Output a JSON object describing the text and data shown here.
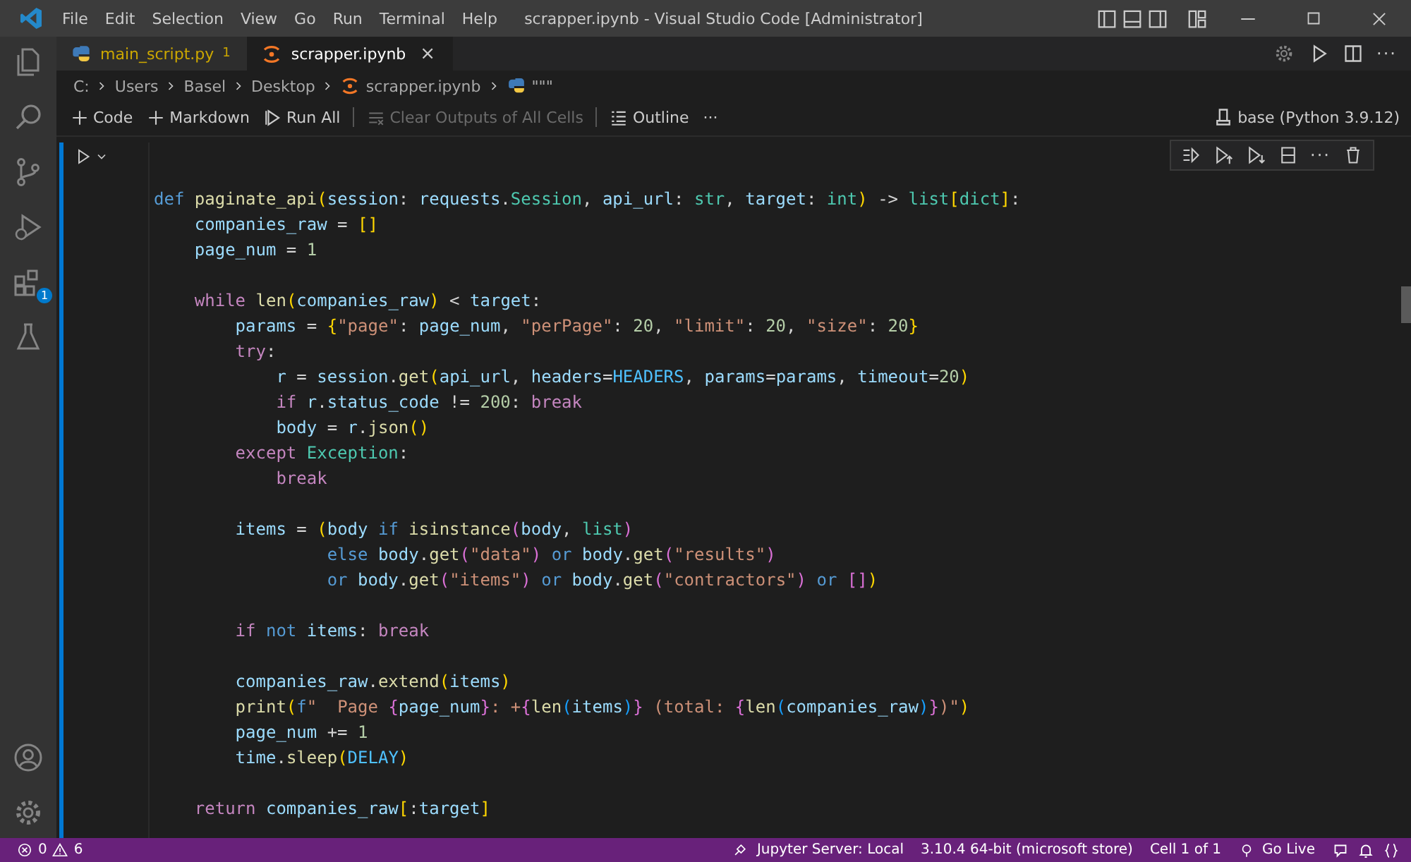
{
  "window": {
    "title": "scrapper.ipynb - Visual Studio Code [Administrator]"
  },
  "menu": [
    "File",
    "Edit",
    "Selection",
    "View",
    "Go",
    "Run",
    "Terminal",
    "Help"
  ],
  "activity_bar": {
    "extensions_badge": "1"
  },
  "tabs": [
    {
      "label": "main_script.py",
      "badge": "1",
      "kind": "python",
      "selected": false
    },
    {
      "label": "scrapper.ipynb",
      "kind": "notebook",
      "selected": true,
      "close": "×"
    }
  ],
  "breadcrumb": [
    {
      "text": "C:",
      "kind": "plain"
    },
    {
      "text": "Users",
      "kind": "plain"
    },
    {
      "text": "Basel",
      "kind": "plain"
    },
    {
      "text": "Desktop",
      "kind": "plain"
    },
    {
      "text": "scrapper.ipynb",
      "kind": "notebook"
    },
    {
      "text": "\"\"\"",
      "kind": "python"
    }
  ],
  "toolbar": [
    {
      "label": "Code",
      "kind": "add",
      "disabled": false
    },
    {
      "label": "Markdown",
      "kind": "add",
      "disabled": false
    },
    {
      "label": "Run All",
      "kind": "run",
      "disabled": false
    },
    {
      "label": "Clear Outputs of All Cells",
      "kind": "clear",
      "disabled": true
    },
    {
      "label": "Outline",
      "kind": "outline",
      "disabled": false
    },
    {
      "label": "···",
      "kind": "more",
      "disabled": false
    }
  ],
  "kernel": "base (Python 3.9.12)",
  "cell_menu": "···",
  "code": [
    {
      "kind": "code",
      "tokens": [
        {
          "kind": "kw",
          "text": "def "
        },
        {
          "kind": "fn",
          "text": "paginate_api"
        },
        {
          "kind": "b1",
          "text": "("
        },
        {
          "kind": "var",
          "text": "session"
        },
        {
          "kind": "op",
          "text": ": "
        },
        {
          "kind": "var",
          "text": "requests"
        },
        {
          "kind": "op",
          "text": "."
        },
        {
          "kind": "cls",
          "text": "Session"
        },
        {
          "kind": "op",
          "text": ", "
        },
        {
          "kind": "var",
          "text": "api_url"
        },
        {
          "kind": "op",
          "text": ": "
        },
        {
          "kind": "cls",
          "text": "str"
        },
        {
          "kind": "op",
          "text": ", "
        },
        {
          "kind": "var",
          "text": "target"
        },
        {
          "kind": "op",
          "text": ": "
        },
        {
          "kind": "cls",
          "text": "int"
        },
        {
          "kind": "b1",
          "text": ")"
        },
        {
          "kind": "op",
          "text": " -> "
        },
        {
          "kind": "cls",
          "text": "list"
        },
        {
          "kind": "b1",
          "text": "["
        },
        {
          "kind": "cls",
          "text": "dict"
        },
        {
          "kind": "b1",
          "text": "]"
        },
        {
          "kind": "op",
          "text": ":"
        }
      ]
    },
    {
      "kind": "code",
      "tokens": [
        {
          "kind": "var",
          "text": "    companies_raw"
        },
        {
          "kind": "op",
          "text": " = "
        },
        {
          "kind": "b1",
          "text": "[]"
        }
      ]
    },
    {
      "kind": "code",
      "tokens": [
        {
          "kind": "var",
          "text": "    page_num"
        },
        {
          "kind": "op",
          "text": " = "
        },
        {
          "kind": "num",
          "text": "1"
        }
      ]
    },
    {
      "kind": "blank"
    },
    {
      "kind": "code",
      "tokens": [
        {
          "kind": "ctl",
          "text": "    while "
        },
        {
          "kind": "fn",
          "text": "len"
        },
        {
          "kind": "b1",
          "text": "("
        },
        {
          "kind": "var",
          "text": "companies_raw"
        },
        {
          "kind": "b1",
          "text": ")"
        },
        {
          "kind": "op",
          "text": " < "
        },
        {
          "kind": "var",
          "text": "target"
        },
        {
          "kind": "op",
          "text": ":"
        }
      ]
    },
    {
      "kind": "code",
      "tokens": [
        {
          "kind": "var",
          "text": "        params"
        },
        {
          "kind": "op",
          "text": " = "
        },
        {
          "kind": "b1",
          "text": "{"
        },
        {
          "kind": "str",
          "text": "\"page\""
        },
        {
          "kind": "op",
          "text": ": "
        },
        {
          "kind": "var",
          "text": "page_num"
        },
        {
          "kind": "op",
          "text": ", "
        },
        {
          "kind": "str",
          "text": "\"perPage\""
        },
        {
          "kind": "op",
          "text": ": "
        },
        {
          "kind": "num",
          "text": "20"
        },
        {
          "kind": "op",
          "text": ", "
        },
        {
          "kind": "str",
          "text": "\"limit\""
        },
        {
          "kind": "op",
          "text": ": "
        },
        {
          "kind": "num",
          "text": "20"
        },
        {
          "kind": "op",
          "text": ", "
        },
        {
          "kind": "str",
          "text": "\"size\""
        },
        {
          "kind": "op",
          "text": ": "
        },
        {
          "kind": "num",
          "text": "20"
        },
        {
          "kind": "b1",
          "text": "}"
        }
      ]
    },
    {
      "kind": "code",
      "tokens": [
        {
          "kind": "ctl",
          "text": "        try"
        },
        {
          "kind": "op",
          "text": ":"
        }
      ]
    },
    {
      "kind": "code",
      "tokens": [
        {
          "kind": "var",
          "text": "            r"
        },
        {
          "kind": "op",
          "text": " = "
        },
        {
          "kind": "var",
          "text": "session"
        },
        {
          "kind": "op",
          "text": "."
        },
        {
          "kind": "fn",
          "text": "get"
        },
        {
          "kind": "b1",
          "text": "("
        },
        {
          "kind": "var",
          "text": "api_url"
        },
        {
          "kind": "op",
          "text": ", "
        },
        {
          "kind": "var",
          "text": "headers"
        },
        {
          "kind": "op",
          "text": "="
        },
        {
          "kind": "const",
          "text": "HEADERS"
        },
        {
          "kind": "op",
          "text": ", "
        },
        {
          "kind": "var",
          "text": "params"
        },
        {
          "kind": "op",
          "text": "="
        },
        {
          "kind": "var",
          "text": "params"
        },
        {
          "kind": "op",
          "text": ", "
        },
        {
          "kind": "var",
          "text": "timeout"
        },
        {
          "kind": "op",
          "text": "="
        },
        {
          "kind": "num",
          "text": "20"
        },
        {
          "kind": "b1",
          "text": ")"
        }
      ]
    },
    {
      "kind": "code",
      "tokens": [
        {
          "kind": "ctl",
          "text": "            if "
        },
        {
          "kind": "var",
          "text": "r"
        },
        {
          "kind": "op",
          "text": "."
        },
        {
          "kind": "var",
          "text": "status_code"
        },
        {
          "kind": "op",
          "text": " != "
        },
        {
          "kind": "num",
          "text": "200"
        },
        {
          "kind": "op",
          "text": ": "
        },
        {
          "kind": "ctl",
          "text": "break"
        }
      ]
    },
    {
      "kind": "code",
      "tokens": [
        {
          "kind": "var",
          "text": "            body"
        },
        {
          "kind": "op",
          "text": " = "
        },
        {
          "kind": "var",
          "text": "r"
        },
        {
          "kind": "op",
          "text": "."
        },
        {
          "kind": "fn",
          "text": "json"
        },
        {
          "kind": "b1",
          "text": "()"
        }
      ]
    },
    {
      "kind": "code",
      "tokens": [
        {
          "kind": "ctl",
          "text": "        except "
        },
        {
          "kind": "cls",
          "text": "Exception"
        },
        {
          "kind": "op",
          "text": ":"
        }
      ]
    },
    {
      "kind": "code",
      "tokens": [
        {
          "kind": "ctl",
          "text": "            break"
        }
      ]
    },
    {
      "kind": "blank"
    },
    {
      "kind": "code",
      "tokens": [
        {
          "kind": "var",
          "text": "        items"
        },
        {
          "kind": "op",
          "text": " = "
        },
        {
          "kind": "b1",
          "text": "("
        },
        {
          "kind": "var",
          "text": "body"
        },
        {
          "kind": "kw",
          "text": " if "
        },
        {
          "kind": "fn",
          "text": "isinstance"
        },
        {
          "kind": "b2",
          "text": "("
        },
        {
          "kind": "var",
          "text": "body"
        },
        {
          "kind": "op",
          "text": ", "
        },
        {
          "kind": "cls",
          "text": "list"
        },
        {
          "kind": "b2",
          "text": ")"
        }
      ]
    },
    {
      "kind": "code",
      "tokens": [
        {
          "kind": "kw",
          "text": "                 else "
        },
        {
          "kind": "var",
          "text": "body"
        },
        {
          "kind": "op",
          "text": "."
        },
        {
          "kind": "fn",
          "text": "get"
        },
        {
          "kind": "b2",
          "text": "("
        },
        {
          "kind": "str",
          "text": "\"data\""
        },
        {
          "kind": "b2",
          "text": ")"
        },
        {
          "kind": "kw",
          "text": " or "
        },
        {
          "kind": "var",
          "text": "body"
        },
        {
          "kind": "op",
          "text": "."
        },
        {
          "kind": "fn",
          "text": "get"
        },
        {
          "kind": "b2",
          "text": "("
        },
        {
          "kind": "str",
          "text": "\"results\""
        },
        {
          "kind": "b2",
          "text": ")"
        }
      ]
    },
    {
      "kind": "code",
      "tokens": [
        {
          "kind": "kw",
          "text": "                 or "
        },
        {
          "kind": "var",
          "text": "body"
        },
        {
          "kind": "op",
          "text": "."
        },
        {
          "kind": "fn",
          "text": "get"
        },
        {
          "kind": "b2",
          "text": "("
        },
        {
          "kind": "str",
          "text": "\"items\""
        },
        {
          "kind": "b2",
          "text": ")"
        },
        {
          "kind": "kw",
          "text": " or "
        },
        {
          "kind": "var",
          "text": "body"
        },
        {
          "kind": "op",
          "text": "."
        },
        {
          "kind": "fn",
          "text": "get"
        },
        {
          "kind": "b2",
          "text": "("
        },
        {
          "kind": "str",
          "text": "\"contractors\""
        },
        {
          "kind": "b2",
          "text": ")"
        },
        {
          "kind": "kw",
          "text": " or "
        },
        {
          "kind": "b2",
          "text": "[]"
        },
        {
          "kind": "b1",
          "text": ")"
        }
      ]
    },
    {
      "kind": "blank"
    },
    {
      "kind": "code",
      "tokens": [
        {
          "kind": "ctl",
          "text": "        if "
        },
        {
          "kind": "kw",
          "text": "not "
        },
        {
          "kind": "var",
          "text": "items"
        },
        {
          "kind": "op",
          "text": ": "
        },
        {
          "kind": "ctl",
          "text": "break"
        }
      ]
    },
    {
      "kind": "blank"
    },
    {
      "kind": "code",
      "tokens": [
        {
          "kind": "var",
          "text": "        companies_raw"
        },
        {
          "kind": "op",
          "text": "."
        },
        {
          "kind": "fn",
          "text": "extend"
        },
        {
          "kind": "b1",
          "text": "("
        },
        {
          "kind": "var",
          "text": "items"
        },
        {
          "kind": "b1",
          "text": ")"
        }
      ]
    },
    {
      "kind": "code",
      "tokens": [
        {
          "kind": "fn",
          "text": "        print"
        },
        {
          "kind": "b1",
          "text": "("
        },
        {
          "kind": "kw",
          "text": "f"
        },
        {
          "kind": "str",
          "text": "\"  Page "
        },
        {
          "kind": "b2",
          "text": "{"
        },
        {
          "kind": "var",
          "text": "page_num"
        },
        {
          "kind": "b2",
          "text": "}"
        },
        {
          "kind": "str",
          "text": ": +"
        },
        {
          "kind": "b2",
          "text": "{"
        },
        {
          "kind": "fn",
          "text": "len"
        },
        {
          "kind": "b3",
          "text": "("
        },
        {
          "kind": "var",
          "text": "items"
        },
        {
          "kind": "b3",
          "text": ")"
        },
        {
          "kind": "b2",
          "text": "}"
        },
        {
          "kind": "str",
          "text": " (total: "
        },
        {
          "kind": "b2",
          "text": "{"
        },
        {
          "kind": "fn",
          "text": "len"
        },
        {
          "kind": "b3",
          "text": "("
        },
        {
          "kind": "var",
          "text": "companies_raw"
        },
        {
          "kind": "b3",
          "text": ")"
        },
        {
          "kind": "b2",
          "text": "}"
        },
        {
          "kind": "str",
          "text": ")\""
        },
        {
          "kind": "b1",
          "text": ")"
        }
      ]
    },
    {
      "kind": "code",
      "tokens": [
        {
          "kind": "var",
          "text": "        page_num"
        },
        {
          "kind": "op",
          "text": " += "
        },
        {
          "kind": "num",
          "text": "1"
        }
      ]
    },
    {
      "kind": "code",
      "tokens": [
        {
          "kind": "var",
          "text": "        time"
        },
        {
          "kind": "op",
          "text": "."
        },
        {
          "kind": "fn",
          "text": "sleep"
        },
        {
          "kind": "b1",
          "text": "("
        },
        {
          "kind": "const",
          "text": "DELAY"
        },
        {
          "kind": "b1",
          "text": ")"
        }
      ]
    },
    {
      "kind": "blank"
    },
    {
      "kind": "code",
      "tokens": [
        {
          "kind": "ctl",
          "text": "    return "
        },
        {
          "kind": "var",
          "text": "companies_raw"
        },
        {
          "kind": "b1",
          "text": "["
        },
        {
          "kind": "op",
          "text": ":"
        },
        {
          "kind": "var",
          "text": "target"
        },
        {
          "kind": "b1",
          "text": "]"
        }
      ]
    }
  ],
  "status_bar": {
    "errors": "0",
    "warnings": "6",
    "right": [
      {
        "text": "Jupyter Server: Local",
        "kind": "server"
      },
      {
        "text": "3.10.4 64-bit (microsoft store)",
        "kind": "plain"
      },
      {
        "text": "Cell 1 of 1",
        "kind": "plain"
      },
      {
        "text": "Go Live",
        "kind": "live"
      }
    ]
  }
}
